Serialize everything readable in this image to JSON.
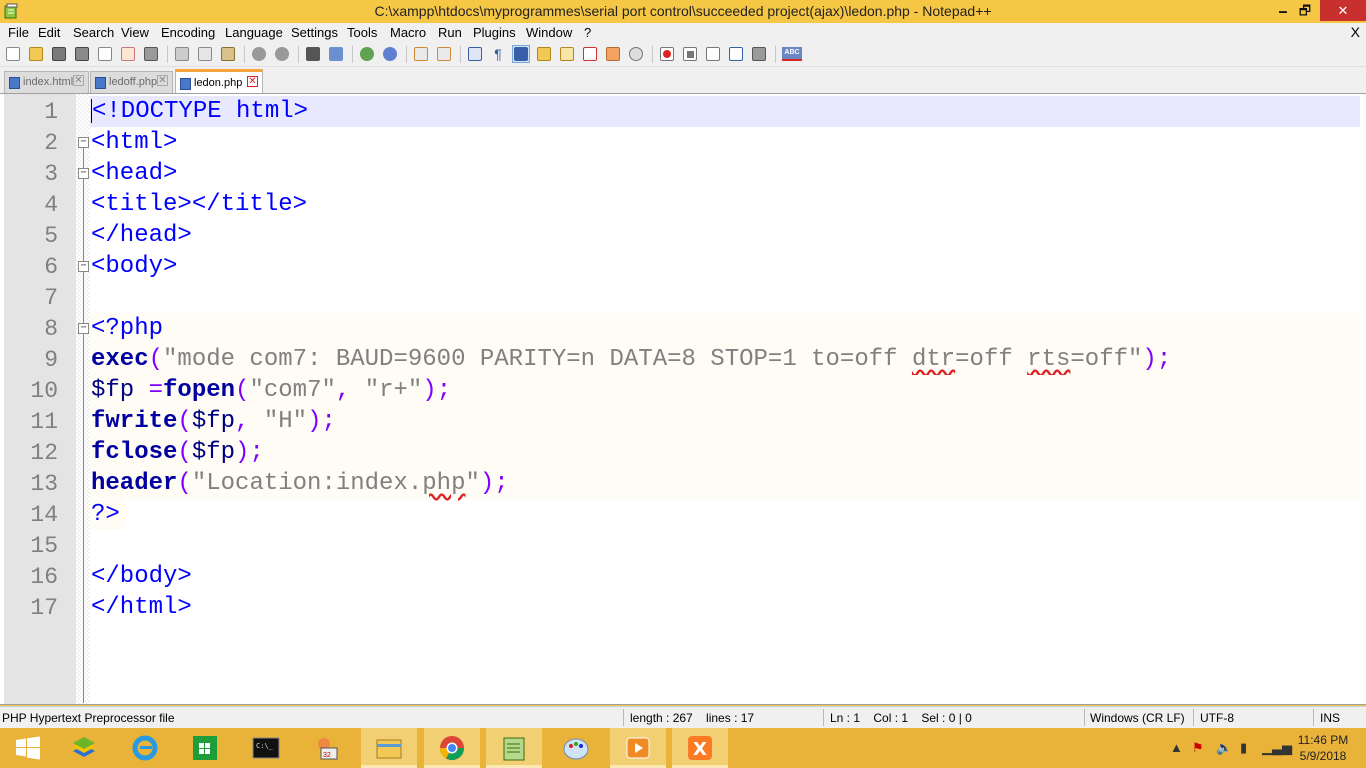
{
  "window": {
    "title": "C:\\xampp\\htdocs\\myprogrammes\\serial port control\\succeeded project(ajax)\\ledon.php - Notepad++",
    "minimize_glyph": "🗕",
    "maximize_glyph": "🗗",
    "close_glyph": "✕"
  },
  "menu": {
    "items": [
      "File",
      "Edit",
      "Search",
      "View",
      "Encoding",
      "Language",
      "Settings",
      "Tools",
      "Macro",
      "Run",
      "Plugins",
      "Window",
      "?"
    ],
    "doc_close": "X"
  },
  "toolbar": {
    "icons": [
      "new-file-icon",
      "open-file-icon",
      "save-icon",
      "save-all-icon",
      "close-icon",
      "close-all-icon",
      "print-icon",
      "cut-icon",
      "copy-icon",
      "paste-icon",
      "undo-icon",
      "redo-icon",
      "find-icon",
      "replace-icon",
      "zoom-in-icon",
      "zoom-out-icon",
      "sync-vertical-icon",
      "sync-horizontal-icon",
      "word-wrap-icon",
      "show-all-chars-icon",
      "indent-guide-icon",
      "doc-map-icon",
      "function-list-icon",
      "folder-workspace-icon",
      "monitor-icon",
      "record-macro-icon",
      "stop-record-icon",
      "playback-icon",
      "run-multiple-icon",
      "save-macro-icon",
      "spell-check-icon"
    ],
    "spellcheck_label": "ABC"
  },
  "tabs": [
    {
      "label": "index.html",
      "active": false
    },
    {
      "label": "ledoff.php",
      "active": false
    },
    {
      "label": "ledon.php",
      "active": true
    }
  ],
  "editor": {
    "lines": [
      {
        "n": "1",
        "text": "<!DOCTYPE html>"
      },
      {
        "n": "2",
        "text": "<html>"
      },
      {
        "n": "3",
        "text": "<head>"
      },
      {
        "n": "4",
        "text": "<title></title>"
      },
      {
        "n": "5",
        "text": "</head>"
      },
      {
        "n": "6",
        "text": "<body>"
      },
      {
        "n": "7",
        "text": ""
      },
      {
        "n": "8",
        "text": "<?php"
      },
      {
        "n": "9",
        "text": "exec(\"mode com7: BAUD=9600 PARITY=n DATA=8 STOP=1 to=off dtr=off rts=off\");"
      },
      {
        "n": "10",
        "text": "$fp =fopen(\"com7\", \"r+\");"
      },
      {
        "n": "11",
        "text": "fwrite($fp, \"H\");"
      },
      {
        "n": "12",
        "text": "fclose($fp);"
      },
      {
        "n": "13",
        "text": "header(\"Location:index.php\");"
      },
      {
        "n": "14",
        "text": "?>"
      },
      {
        "n": "15",
        "text": ""
      },
      {
        "n": "16",
        "text": "</body>"
      },
      {
        "n": "17",
        "text": "</html>"
      }
    ]
  },
  "status": {
    "filetype": "PHP Hypertext Preprocessor file",
    "length": "length : 267    lines : 17",
    "position": "Ln : 1    Col : 1    Sel : 0 | 0",
    "eol": "Windows (CR LF)",
    "encoding": "UTF-8",
    "mode": "INS"
  },
  "taskbar": {
    "apps": [
      "start-icon",
      "bluestacks-icon",
      "internet-explorer-icon",
      "store-icon",
      "command-prompt-icon",
      "app-icon",
      "file-explorer-icon",
      "chrome-icon",
      "notepadpp-icon",
      "paint-icon",
      "media-player-icon",
      "xampp-icon"
    ],
    "clock_time": "11:46 PM",
    "clock_date": "5/9/2018"
  }
}
